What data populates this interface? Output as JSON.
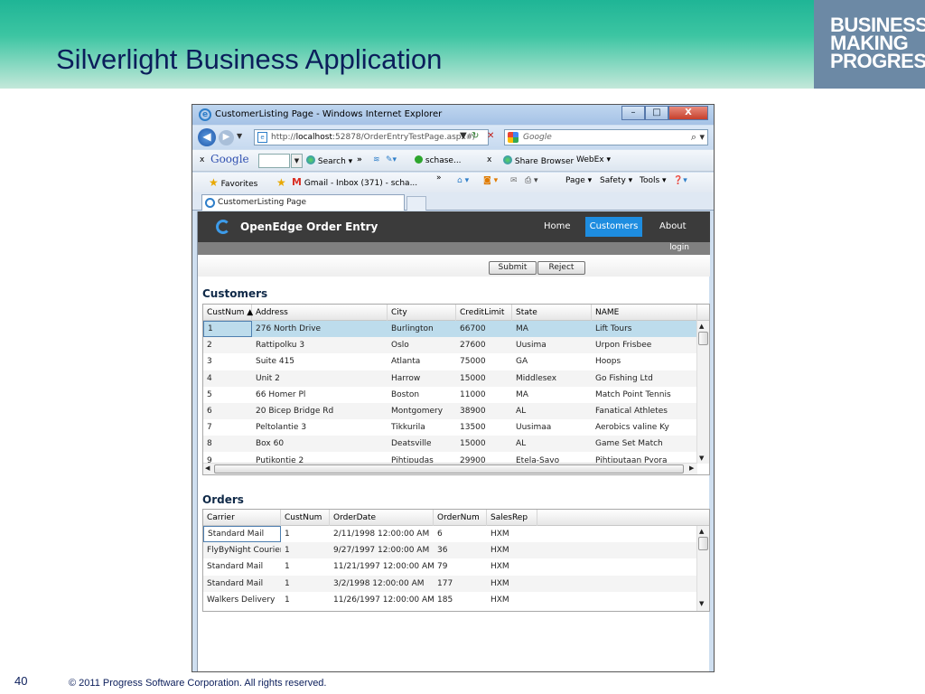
{
  "slide": {
    "title": "Silverlight Business Application",
    "logo_lines": [
      "BUSINESS",
      "MAKING",
      "PROGRESS."
    ],
    "page_number": "40",
    "copyright": "© 2011 Progress Software Corporation. All rights reserved."
  },
  "browser": {
    "title": "CustomerListing Page - Windows Internet Explorer",
    "controls": [
      "–",
      "□",
      "X"
    ],
    "address_prefix": "http://",
    "address_host": "localhost",
    "address_rest": ":52878/OrderEntryTestPage.aspx#/",
    "search_placeholder": "Google",
    "google_toolbar": {
      "close": "x",
      "logo": "Google",
      "search": "Search ▾",
      "chevron": "»",
      "schase": "schase...",
      "close2": "x",
      "share": "Share Browser",
      "webex": "WebEx ▾"
    },
    "favorites": {
      "label": "Favorites",
      "gmail": "Gmail - Inbox (371) - scha...",
      "chevron": "»",
      "page": "Page ▾",
      "safety": "Safety ▾",
      "tools": "Tools ▾"
    },
    "tab_label": "CustomerListing Page"
  },
  "app": {
    "title": "OpenEdge Order Entry",
    "nav": {
      "home": "Home",
      "customers": "Customers",
      "about": "About"
    },
    "login": "login",
    "submit": "Submit",
    "reject": "Reject",
    "customers_title": "Customers",
    "customer_columns": [
      "CustNum ▲",
      "Address",
      "City",
      "CreditLimit",
      "State",
      "NAME"
    ],
    "customers": [
      [
        "1",
        "276 North Drive",
        "Burlington",
        "66700",
        "MA",
        "Lift Tours"
      ],
      [
        "2",
        "Rattipolku 3",
        "Oslo",
        "27600",
        "Uusima",
        "Urpon Frisbee"
      ],
      [
        "3",
        "Suite 415",
        "Atlanta",
        "75000",
        "GA",
        "Hoops"
      ],
      [
        "4",
        "Unit 2",
        "Harrow",
        "15000",
        "Middlesex",
        "Go Fishing Ltd"
      ],
      [
        "5",
        "66 Homer Pl",
        "Boston",
        "11000",
        "MA",
        "Match Point Tennis"
      ],
      [
        "6",
        "20 Bicep Bridge Rd",
        "Montgomery",
        "38900",
        "AL",
        "Fanatical Athletes"
      ],
      [
        "7",
        "Peltolantie 3",
        "Tikkurila",
        "13500",
        "Uusimaa",
        "Aerobics valine Ky"
      ],
      [
        "8",
        "Box 60",
        "Deatsville",
        "15000",
        "AL",
        "Game Set Match"
      ],
      [
        "9",
        "Putikontie 2",
        "Pihtipudas",
        "29900",
        "Etela-Savo",
        "Pihtiputaan Pyora"
      ]
    ],
    "orders_title": "Orders",
    "order_columns": [
      "Carrier",
      "CustNum",
      "OrderDate",
      "OrderNum",
      "SalesRep"
    ],
    "orders": [
      [
        "Standard Mail",
        "1",
        "2/11/1998 12:00:00 AM",
        "6",
        "HXM"
      ],
      [
        "FlyByNight Courier",
        "1",
        "9/27/1997 12:00:00 AM",
        "36",
        "HXM"
      ],
      [
        "Standard Mail",
        "1",
        "11/21/1997 12:00:00 AM",
        "79",
        "HXM"
      ],
      [
        "Standard Mail",
        "1",
        "3/2/1998 12:00:00 AM",
        "177",
        "HXM"
      ],
      [
        "Walkers Delivery",
        "1",
        "11/26/1997 12:00:00 AM",
        "185",
        "HXM"
      ]
    ]
  },
  "colors": {
    "header_green": "#1fb596",
    "title_navy": "#0b1e5b",
    "logo_box": "#6c89a5",
    "app_header": "#3b3b3b",
    "nav_active": "#1e8de0",
    "selected_row": "#bddcec"
  }
}
